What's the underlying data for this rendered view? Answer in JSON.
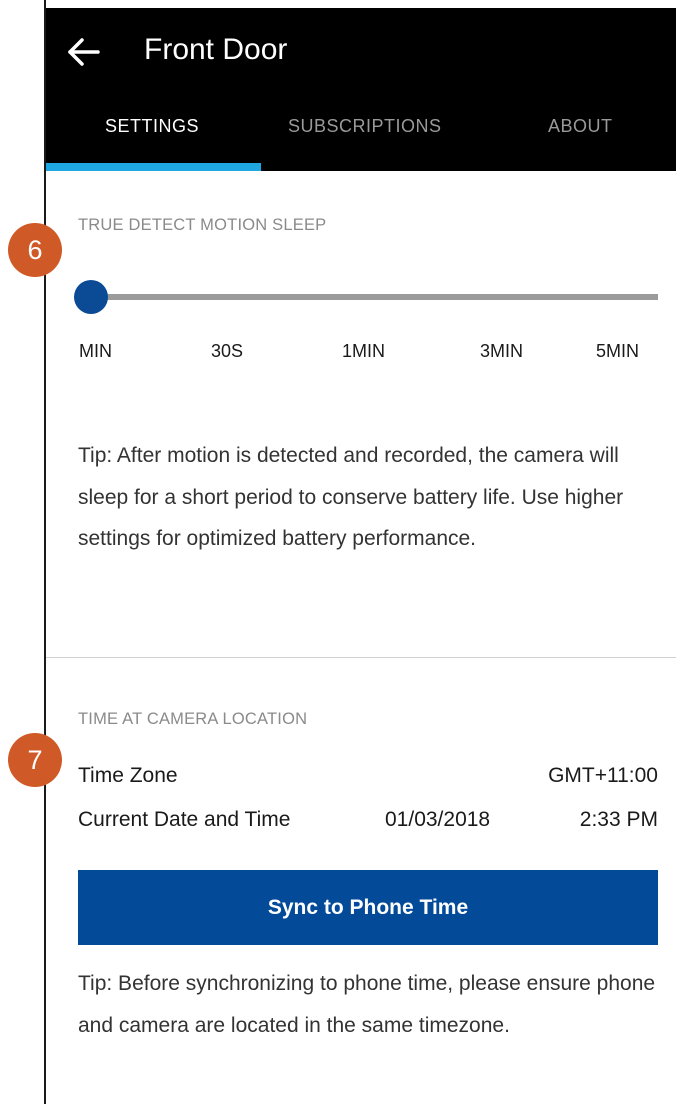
{
  "header": {
    "title": "Front Door",
    "tabs": [
      {
        "label": "SETTINGS",
        "active": true
      },
      {
        "label": "SUBSCRIPTIONS",
        "active": false
      },
      {
        "label": "ABOUT",
        "active": false
      }
    ]
  },
  "motion_sleep": {
    "label": "TRUE DETECT MOTION SLEEP",
    "stops": [
      "MIN",
      "30S",
      "1MIN",
      "3MIN",
      "5MIN"
    ],
    "selected": "MIN",
    "tip": "Tip: After motion is detected and recorded, the camera will sleep for a short period to conserve battery life. Use higher settings for optimized battery performance."
  },
  "time_location": {
    "label": "TIME AT CAMERA LOCATION",
    "time_zone_label": "Time Zone",
    "time_zone_value": "GMT+11:00",
    "datetime_label": "Current Date and Time",
    "date_value": "01/03/2018",
    "time_value": "2:33 PM",
    "sync_button_label": "Sync to Phone Time",
    "tip": "Tip: Before synchronizing to phone time, please ensure phone and camera are located in the same timezone."
  },
  "callouts": [
    "6",
    "7"
  ],
  "colors": {
    "header_bg": "#000000",
    "tab_indicator": "#1ea7e1",
    "primary_button": "#034a99",
    "slider_thumb": "#0b4a95",
    "callout": "#d05a27"
  }
}
